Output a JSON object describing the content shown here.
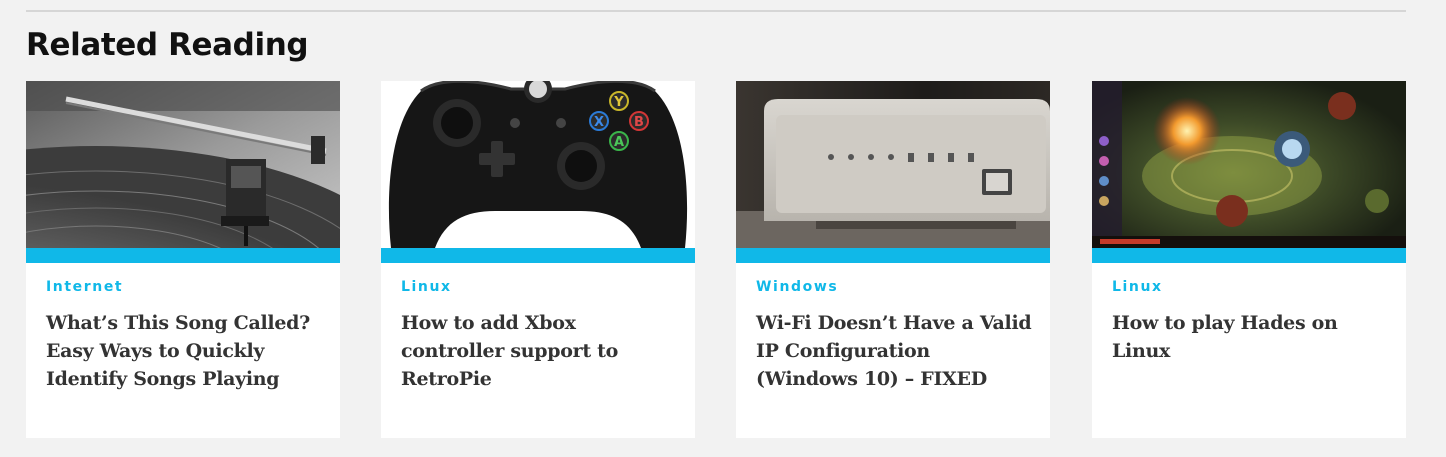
{
  "section": {
    "title": "Related Reading"
  },
  "colors": {
    "accent": "#10b8e8",
    "card_bg": "#ffffff",
    "page_bg": "#f2f2f2",
    "title_text": "#333333"
  },
  "cards": [
    {
      "category": "Internet",
      "title": "What’s This Song Called? Easy Ways to Quickly Identify Songs Playing",
      "image_icon": "turntable-photo"
    },
    {
      "category": "Linux",
      "title": "How to add Xbox controller support to RetroPie",
      "image_icon": "xbox-controller-photo"
    },
    {
      "category": "Windows",
      "title": "Wi-Fi Doesn’t Have a Valid IP Configuration (Windows 10) – FIXED",
      "image_icon": "router-photo"
    },
    {
      "category": "Linux",
      "title": "How to play Hades on Linux",
      "image_icon": "hades-game-screenshot"
    }
  ]
}
